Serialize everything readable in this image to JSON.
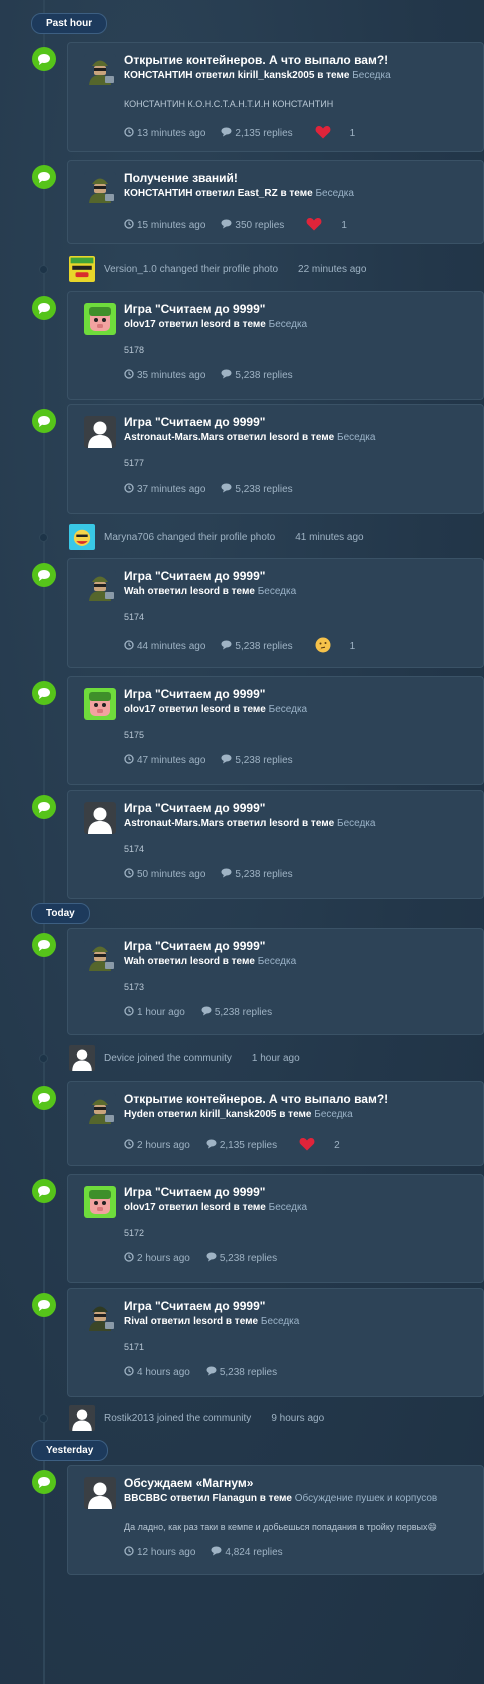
{
  "groups": {
    "past_hour": "Past hour",
    "today": "Today",
    "yesterday": "Yesterday"
  },
  "labels": {
    "replied": "ответил",
    "in_topic": "в теме",
    "changed_photo": "changed their profile photo",
    "joined": "joined the community"
  },
  "colors": {
    "event_icon": "#56c41a",
    "day_pill": "#1d3a5c",
    "card_bg": "#2d4357",
    "forum_link": "#9bb3c8",
    "heart": "#e0243a"
  },
  "posts": [
    {
      "title": "Открытие контейнеров. А что выпало вам?!",
      "author": "КОНСТАНТИН",
      "target": "kirill_kansk2005",
      "forum": "Беседка",
      "snippet": "КОНСТАНТИН К.О.Н.С.Т.А.Н.Т.И.Н КОНСТАНТИН",
      "time": "13 minutes ago",
      "replies": "2,135 replies",
      "reaction_icon": "heart-icon",
      "reaction_count": "1",
      "avatar": "tank-soldier"
    },
    {
      "title": "Получение званий!",
      "author": "КОНСТАНТИН",
      "target": "East_RZ",
      "forum": "Беседка",
      "snippet": "",
      "time": "15 minutes ago",
      "replies": "350 replies",
      "reaction_icon": "heart-icon",
      "reaction_count": "1",
      "avatar": "tank-soldier"
    },
    {
      "title": "Игра \"Считаем до 9999\"",
      "author": "olov17",
      "target": "lesord",
      "forum": "Беседка",
      "snippet": "5178",
      "time": "35 minutes ago",
      "replies": "5,238 replies",
      "reaction_icon": "",
      "reaction_count": "",
      "avatar": "green-pig"
    },
    {
      "title": "Игра \"Считаем до 9999\"",
      "author": "Astronaut-Mars.Mars",
      "target": "lesord",
      "forum": "Беседка",
      "snippet": "5177",
      "time": "37 minutes ago",
      "replies": "5,238 replies",
      "reaction_icon": "",
      "reaction_count": "",
      "avatar": "default-user"
    },
    {
      "title": "Игра \"Считаем до 9999\"",
      "author": "Wah",
      "target": "lesord",
      "forum": "Беседка",
      "snippet": "5174",
      "time": "44 minutes ago",
      "replies": "5,238 replies",
      "reaction_icon": "thinking-emoji-icon",
      "reaction_count": "1",
      "avatar": "tank-soldier"
    },
    {
      "title": "Игра \"Считаем до 9999\"",
      "author": "olov17",
      "target": "lesord",
      "forum": "Беседка",
      "snippet": "5175",
      "time": "47 minutes ago",
      "replies": "5,238 replies",
      "reaction_icon": "",
      "reaction_count": "",
      "avatar": "green-pig"
    },
    {
      "title": "Игра \"Считаем до 9999\"",
      "author": "Astronaut-Mars.Mars",
      "target": "lesord",
      "forum": "Беседка",
      "snippet": "5174",
      "time": "50 minutes ago",
      "replies": "5,238 replies",
      "reaction_icon": "",
      "reaction_count": "",
      "avatar": "default-user"
    },
    {
      "title": "Игра \"Считаем до 9999\"",
      "author": "Wah",
      "target": "lesord",
      "forum": "Беседка",
      "snippet": "5173",
      "time": "1 hour ago",
      "replies": "5,238 replies",
      "reaction_icon": "",
      "reaction_count": "",
      "avatar": "tank-soldier"
    },
    {
      "title": "Открытие контейнеров. А что выпало вам?!",
      "author": "Hyden",
      "target": "kirill_kansk2005",
      "forum": "Беседка",
      "snippet": "",
      "time": "2 hours ago",
      "replies": "2,135 replies",
      "reaction_icon": "heart-icon",
      "reaction_count": "2",
      "avatar": "tank-soldier"
    },
    {
      "title": "Игра \"Считаем до 9999\"",
      "author": "olov17",
      "target": "lesord",
      "forum": "Беседка",
      "snippet": "5172",
      "time": "2 hours ago",
      "replies": "5,238 replies",
      "reaction_icon": "",
      "reaction_count": "",
      "avatar": "green-pig"
    },
    {
      "title": "Игра \"Считаем до 9999\"",
      "author": "Rival",
      "target": "lesord",
      "forum": "Беседка",
      "snippet": "5171",
      "time": "4 hours ago",
      "replies": "5,238 replies",
      "reaction_icon": "",
      "reaction_count": "",
      "avatar": "tank-soldier-dark"
    },
    {
      "title": "Обсуждаем «Магнум»",
      "author": "BBCBBC",
      "target": "Flanagun",
      "forum": "Обсуждение пушек и корпусов",
      "snippet": "Да ладно, как раз таки в кемпе и добьешься попадания в тройку первых😄",
      "time": "12 hours ago",
      "replies": "4,824 replies",
      "reaction_icon": "",
      "reaction_count": "",
      "avatar": "default-user"
    }
  ],
  "activities": [
    {
      "user": "Version_1.0",
      "action": "changed their profile photo",
      "time": "22 minutes ago",
      "avatar": "yellow-character"
    },
    {
      "user": "Maryna706",
      "action": "changed their profile photo",
      "time": "41 minutes ago",
      "avatar": "cyan-character"
    },
    {
      "user": "Device",
      "action": "joined the community",
      "time": "1 hour ago",
      "avatar": "default-user"
    },
    {
      "user": "Rostik2013",
      "action": "joined the community",
      "time": "9 hours ago",
      "avatar": "default-user"
    }
  ]
}
